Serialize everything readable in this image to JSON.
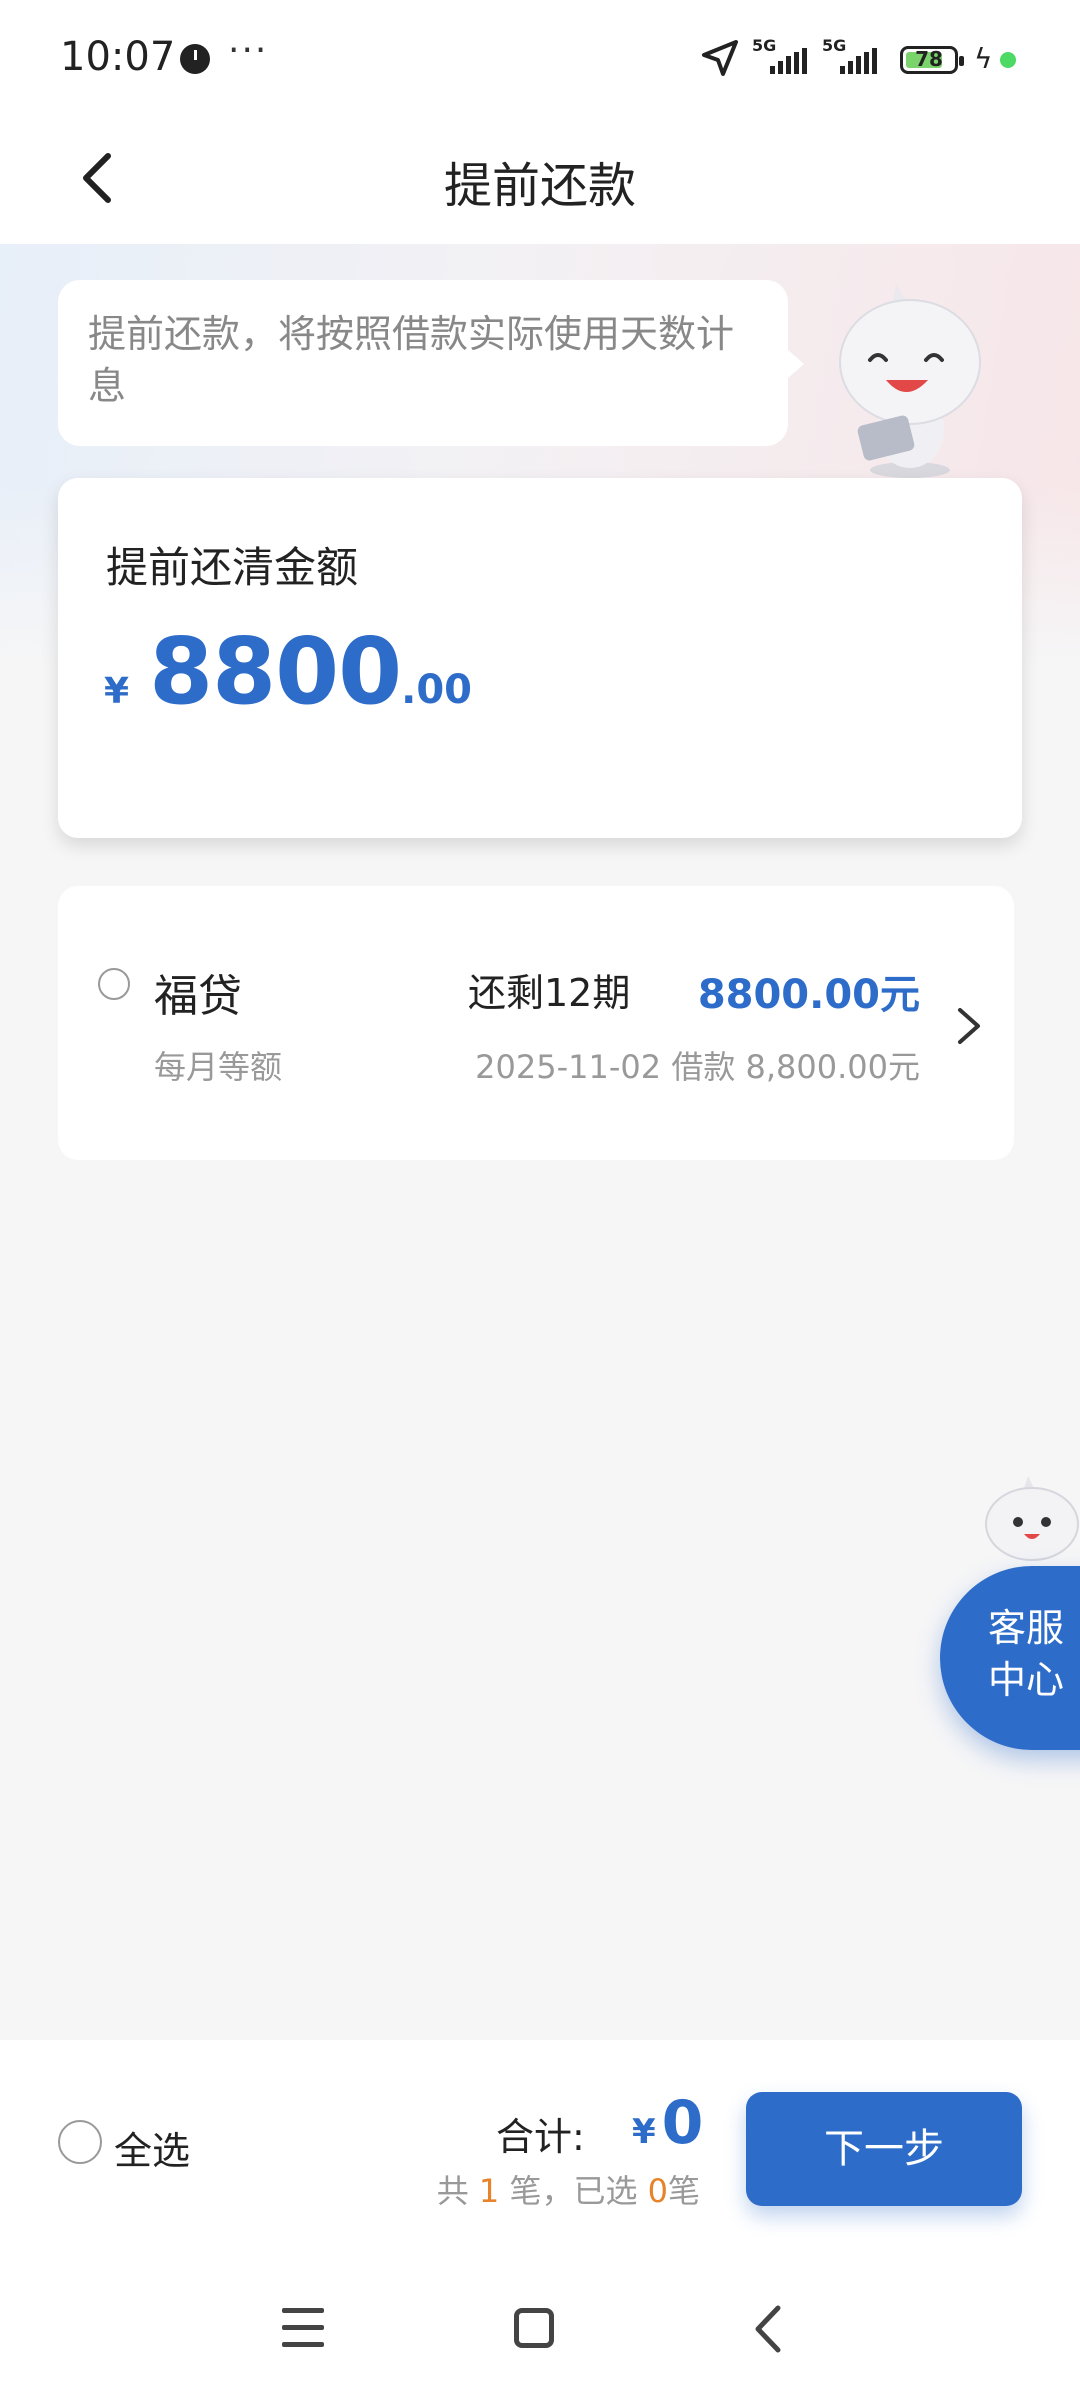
{
  "status_bar": {
    "time": "10:07",
    "more": "···",
    "network_1": "5G",
    "network_2": "5G",
    "battery": "78"
  },
  "header": {
    "title": "提前还款"
  },
  "notice": {
    "text": "提前还款，将按照借款实际使用天数计息"
  },
  "summary_card": {
    "label": "提前还清金额",
    "currency": "¥",
    "amount_integer": "8800",
    "amount_decimal": ".00"
  },
  "loans": [
    {
      "name": "福贷",
      "repay_type": "每月等额",
      "remaining": "还剩12期",
      "amount": "8800.00元",
      "detail": "2025-11-02 借款 8,800.00元",
      "selected": false
    }
  ],
  "service": {
    "line1": "客服",
    "line2": "中心"
  },
  "footer": {
    "select_all": "全选",
    "total_label": "合计:",
    "total_currency": "¥",
    "total_value": "0",
    "count_prefix": "共",
    "count_total": "1",
    "count_mid": "笔，已选",
    "count_selected": "0",
    "count_suffix": "笔",
    "next_button": "下一步"
  },
  "colors": {
    "accent": "#2e6cc9",
    "highlight": "#e8832a",
    "battery": "#7bd36b"
  }
}
